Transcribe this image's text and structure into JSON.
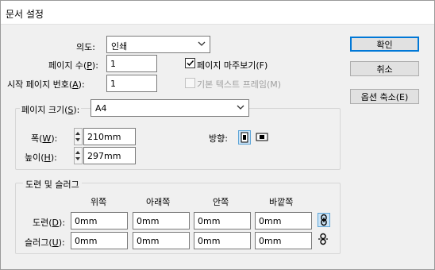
{
  "window": {
    "title": "문서 설정"
  },
  "intent": {
    "label": "의도:",
    "value": "인쇄"
  },
  "pages": {
    "label_text": "페이지 수(",
    "label_key": "P",
    "label_end": "):",
    "value": "1"
  },
  "facing_pages": {
    "label": "페이지 마주보기(F)",
    "checked": true
  },
  "start_page": {
    "label_text": "시작 페이지 번호(",
    "label_key": "A",
    "label_end": "):",
    "value": "1"
  },
  "master_text_frame": {
    "label": "기본 텍스트 프레임(M)",
    "checked": false,
    "enabled": false
  },
  "page_size": {
    "label_text": "페이지 크기(",
    "label_key": "S",
    "label_end": "):",
    "value": "A4",
    "width_label_text": "폭(",
    "width_label_key": "W",
    "width_label_end": "):",
    "width_value": "210mm",
    "height_label_text": "높이(",
    "height_label_key": "H",
    "height_label_end": "):",
    "height_value": "297mm",
    "orientation_label": "방향:"
  },
  "bleed_slug": {
    "title": "도련 및 슬러그",
    "columns": [
      "위쪽",
      "아래쪽",
      "안쪽",
      "바깥쪽"
    ],
    "bleed": {
      "label_text": "도련(",
      "label_key": "D",
      "label_end": "):",
      "values": [
        "0mm",
        "0mm",
        "0mm",
        "0mm"
      ]
    },
    "slug": {
      "label_text": "슬러그(",
      "label_key": "U",
      "label_end": "):",
      "values": [
        "0mm",
        "0mm",
        "0mm",
        "0mm"
      ]
    }
  },
  "buttons": {
    "ok": "확인",
    "cancel": "취소",
    "fewer_options": "옵션 축소(E)"
  }
}
